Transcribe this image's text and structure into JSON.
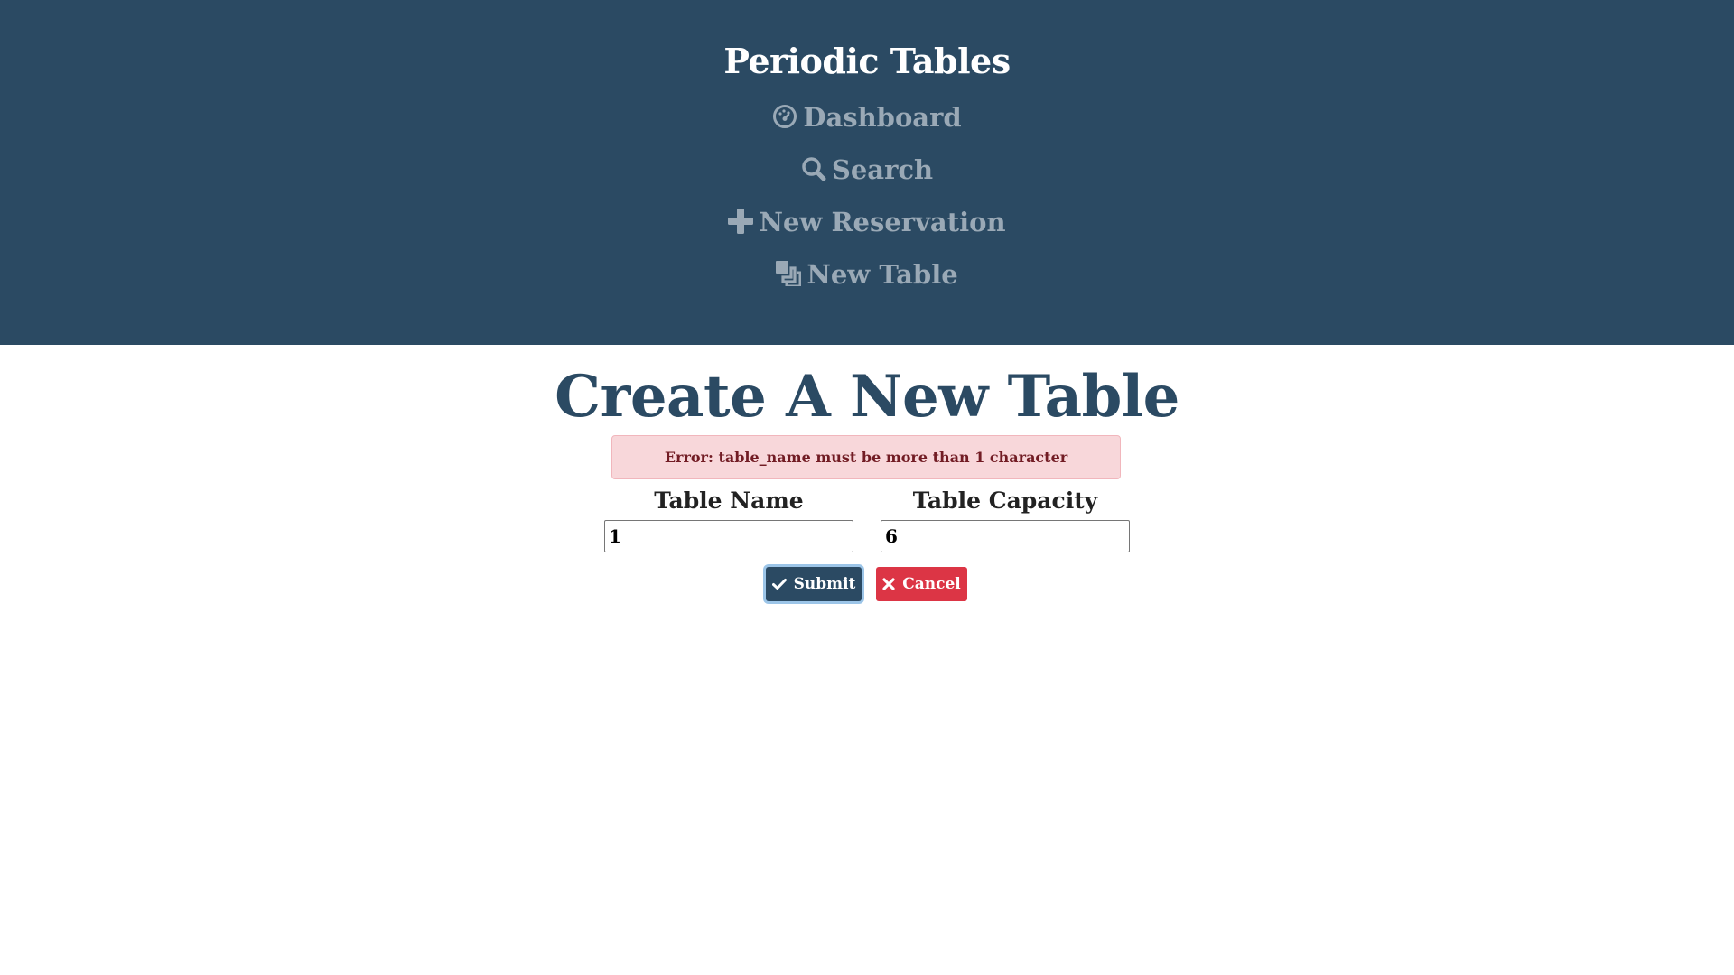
{
  "header": {
    "brand": "Periodic Tables",
    "nav": [
      {
        "label": "Dashboard",
        "icon": "dashboard-icon"
      },
      {
        "label": "Search",
        "icon": "search-icon"
      },
      {
        "label": "New Reservation",
        "icon": "plus-icon"
      },
      {
        "label": "New Table",
        "icon": "layers-icon"
      }
    ],
    "background_color": "#2b4a63",
    "nav_color": "#9aa9b6"
  },
  "main": {
    "title": "Create A New Table",
    "error": "Error: table_name must be more than 1 character",
    "form": {
      "table_name_label": "Table Name",
      "table_name_value": "1",
      "table_capacity_label": "Table Capacity",
      "table_capacity_value": "6",
      "submit_label": "Submit",
      "cancel_label": "Cancel"
    },
    "colors": {
      "title": "#2b4a63",
      "error_bg": "#f8d7da",
      "error_text": "#721c24",
      "submit": "#2b4a63",
      "cancel": "#dc3545"
    }
  }
}
